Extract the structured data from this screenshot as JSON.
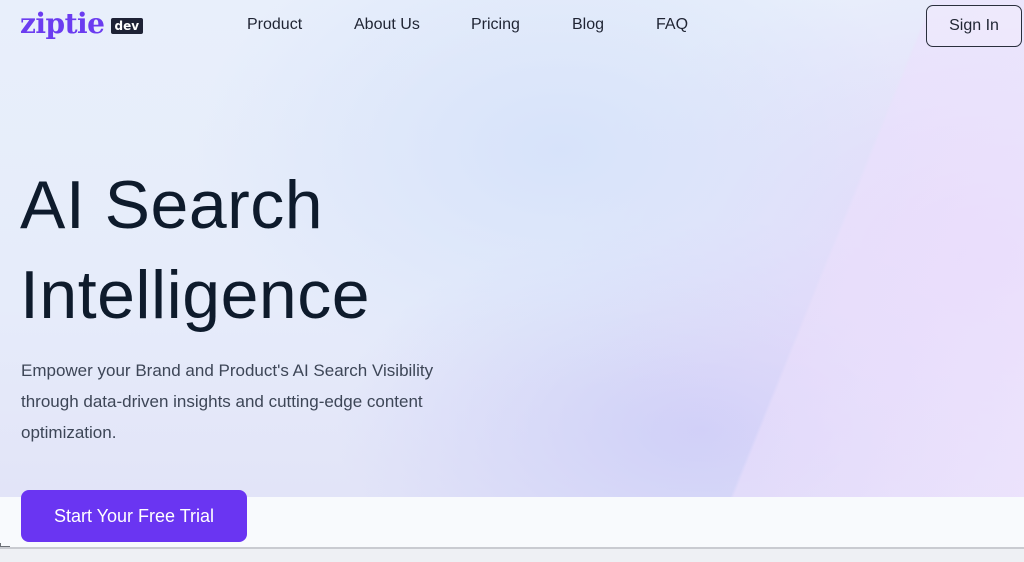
{
  "header": {
    "logo": {
      "word": "ziptie",
      "badge": "dev"
    },
    "nav": [
      {
        "label": "Product"
      },
      {
        "label": "About Us"
      },
      {
        "label": "Pricing"
      },
      {
        "label": "Blog"
      },
      {
        "label": "FAQ"
      }
    ],
    "sign_in_label": "Sign In"
  },
  "hero": {
    "title_line1": "AI Search",
    "title_line2": "Intelligence",
    "subtitle": "Empower your Brand and Product's AI Search Visibility through data-driven insights and cutting-edge content optimization.",
    "cta_label": "Start Your Free Trial"
  },
  "colors": {
    "brand": "#6b3cf0",
    "cta": "#6a35f2",
    "heading": "#0e1b2c",
    "body_text": "#3d4657"
  }
}
